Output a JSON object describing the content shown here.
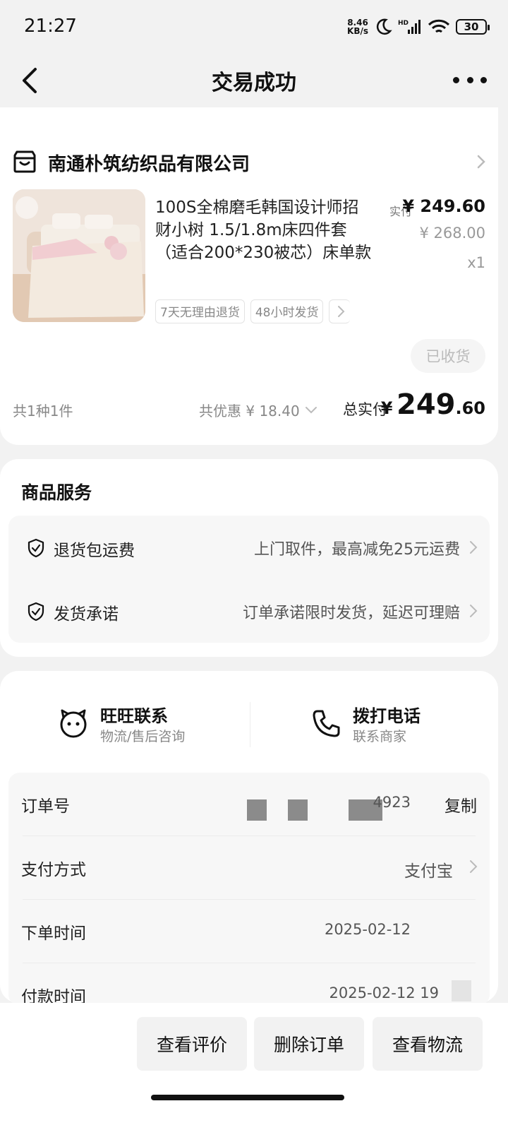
{
  "status_bar": {
    "time": "21:27",
    "net_speed_top": "8.46",
    "net_speed_bottom": "KB/s",
    "battery": "30"
  },
  "header": {
    "title": "交易成功"
  },
  "shop": {
    "name": "南通朴筑纺织品有限公司"
  },
  "product": {
    "title": "100S全棉磨毛韩国设计师招财小树 1.5/1.8m床四件套（适合200*230被芯）床单款",
    "tags": [
      "7天无理由退货",
      "48小时发货"
    ],
    "paid_label": "实付",
    "paid_price": "¥ 249.60",
    "original_price": "¥ 268.00",
    "quantity": "x1",
    "status_button": "已收货"
  },
  "summary": {
    "count": "共1种1件",
    "discount": "共优惠 ¥ 18.40",
    "total_label": "总实付",
    "total_currency": "¥",
    "total_int": "249",
    "total_dec": ".60"
  },
  "services": {
    "title": "商品服务",
    "items": [
      {
        "name": "退货包运费",
        "value": "上门取件，最高减免25元运费"
      },
      {
        "name": "发货承诺",
        "value": "订单承诺限时发货，延迟可理赔"
      }
    ]
  },
  "contact": {
    "wangwang_title": "旺旺联系",
    "wangwang_sub": "物流/售后咨询",
    "phone_title": "拨打电话",
    "phone_sub": "联系商家"
  },
  "order_info": {
    "order_no_label": "订单号",
    "order_no_suffix": "4923",
    "copy_label": "复制",
    "pay_method_label": "支付方式",
    "pay_method_value": "支付宝",
    "order_time_label": "下单时间",
    "order_time_value": "2025-02-12",
    "pay_time_label": "付款时间",
    "pay_time_value": "2025-02-12 19"
  },
  "actions": {
    "review": "查看评价",
    "delete": "删除订单",
    "logistics": "查看物流"
  }
}
